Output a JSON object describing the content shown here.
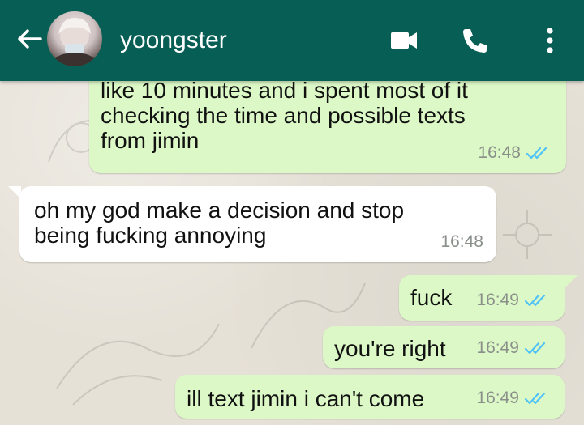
{
  "header": {
    "contact_name": "yoongster",
    "icons": [
      "back-arrow-icon",
      "avatar",
      "video-call-icon",
      "voice-call-icon",
      "more-options-icon"
    ]
  },
  "messages": [
    {
      "direction": "outgoing",
      "text": "like 10 minutes and i spent most of it\nchecking the time and possible texts\nfrom jimin",
      "time": "16:48",
      "status": "read"
    },
    {
      "direction": "incoming",
      "text": "oh my god make a decision and stop\nbeing fucking annoying",
      "time": "16:48"
    },
    {
      "direction": "outgoing",
      "text": "fuck",
      "time": "16:49",
      "status": "read"
    },
    {
      "direction": "outgoing",
      "text": "you're right",
      "time": "16:49",
      "status": "read"
    },
    {
      "direction": "outgoing",
      "text": "ill text jimin i can't come",
      "time": "16:49",
      "status": "read"
    }
  ],
  "colors": {
    "header": "#075e54",
    "outgoing_bubble": "#dcf8c6",
    "incoming_bubble": "#ffffff",
    "read_ticks": "#4fc3f7",
    "timestamp": "#8a8f8a"
  }
}
